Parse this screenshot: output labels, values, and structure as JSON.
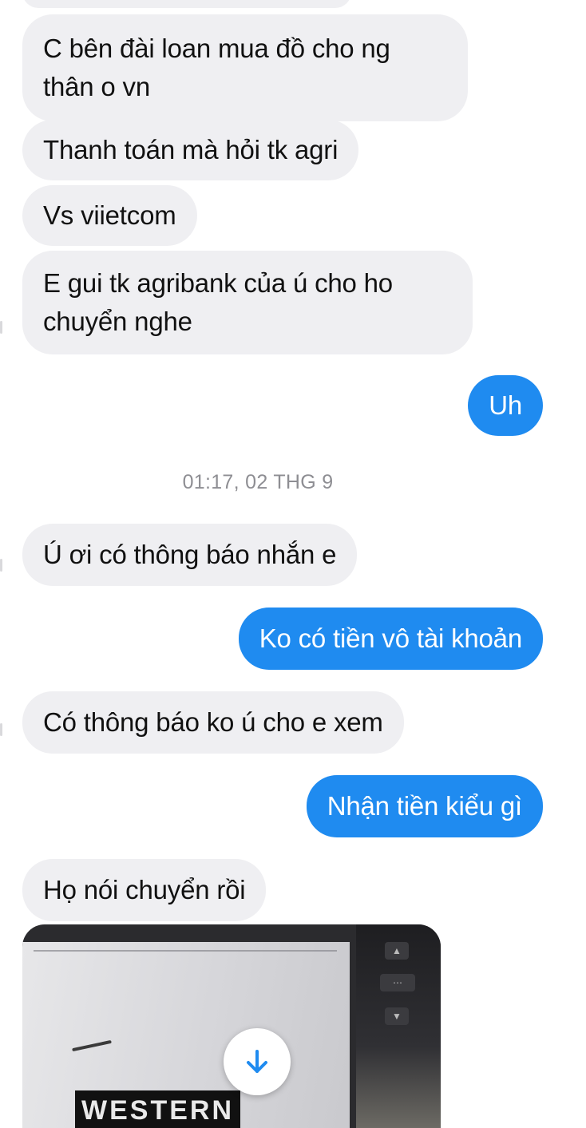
{
  "conversation": {
    "messages": [
      {
        "direction": "incoming",
        "lines": [
          "C bên đài loan mua đồ cho ng",
          "thân o vn"
        ]
      },
      {
        "direction": "incoming",
        "lines": [
          "Thanh toán mà hỏi tk agri"
        ]
      },
      {
        "direction": "incoming",
        "lines": [
          "Vs viietcom"
        ]
      },
      {
        "direction": "incoming",
        "lines": [
          "E gui tk agribank của ú cho ho",
          "chuyển nghe"
        ]
      },
      {
        "direction": "outgoing",
        "lines": [
          "Uh"
        ]
      },
      {
        "direction": "incoming",
        "lines": [
          "Ú ơi có thông báo nhắn e"
        ]
      },
      {
        "direction": "outgoing",
        "lines": [
          "Ko có tiền vô tài khoản"
        ]
      },
      {
        "direction": "incoming",
        "lines": [
          "Có thông báo ko ú cho e xem"
        ]
      },
      {
        "direction": "outgoing",
        "lines": [
          "Nhận tiền kiểu gì"
        ]
      },
      {
        "direction": "incoming",
        "lines": [
          "Họ nói chuyển rồi"
        ]
      }
    ],
    "timestamp": "01:17, 02 THG 9",
    "photo": {
      "brand_text": "WESTERN",
      "download_icon": "arrow-down-icon"
    }
  },
  "colors": {
    "incoming_bubble": "#efeff2",
    "outgoing_bubble": "#1f8bf0",
    "timestamp_text": "#8e8e93"
  }
}
